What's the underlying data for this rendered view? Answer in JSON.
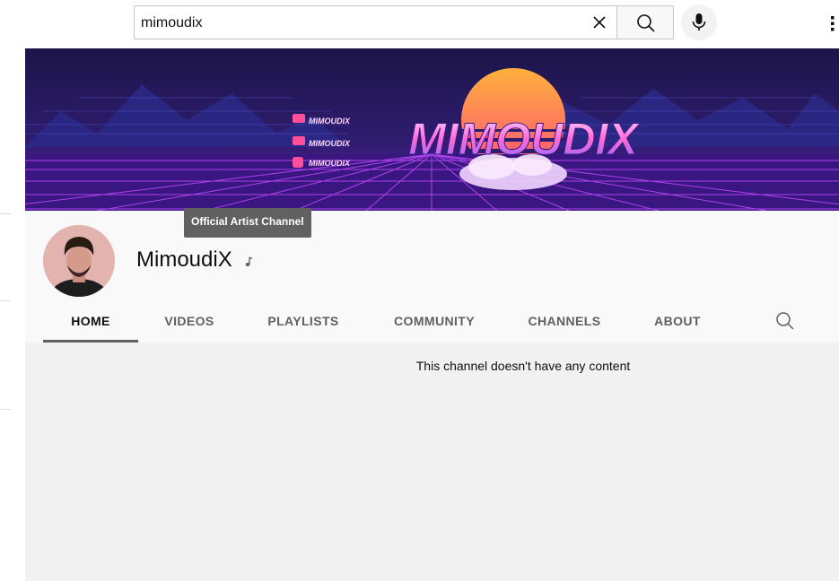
{
  "search": {
    "query": "mimoudix"
  },
  "icons": {
    "clear": "close-icon",
    "search": "search-icon",
    "mic": "microphone-icon",
    "more": "more-vert-icon",
    "note": "music-note-icon",
    "tab_search": "search-icon"
  },
  "banner": {
    "logo_text": "MIMOUDIX",
    "social": [
      {
        "icon": "youtube-icon",
        "label": "MIMOUDIX"
      },
      {
        "icon": "twitter-icon",
        "label": "MIMOUDIX"
      },
      {
        "icon": "instagram-icon",
        "label": "MIMOUDIX"
      }
    ]
  },
  "channel": {
    "name": "MimoudiX",
    "tooltip": "Official Artist Channel"
  },
  "tabs": [
    {
      "label": "HOME",
      "active": true
    },
    {
      "label": "VIDEOS",
      "active": false
    },
    {
      "label": "PLAYLISTS",
      "active": false
    },
    {
      "label": "COMMUNITY",
      "active": false
    },
    {
      "label": "CHANNELS",
      "active": false
    },
    {
      "label": "ABOUT",
      "active": false
    }
  ],
  "content": {
    "empty_message": "This channel doesn't have any content"
  },
  "colors": {
    "header_bg": "#f9f9f9",
    "content_bg": "#f1f1f1",
    "tab_text": "#606060",
    "tooltip_bg": "#616161"
  }
}
